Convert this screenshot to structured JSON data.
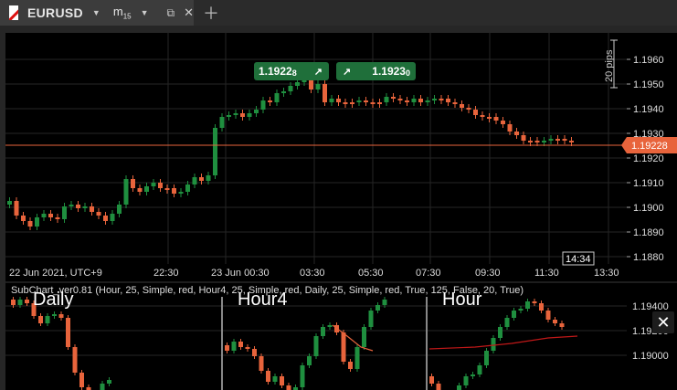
{
  "tab": {
    "symbol": "EURUSD",
    "timeframe_main": "m",
    "timeframe_sub": "15",
    "detach_icon": "detach-icon",
    "close_icon": "close-icon"
  },
  "main_chart": {
    "price_ticks": [
      "1.1960",
      "1.1950",
      "1.1940",
      "1.1930",
      "1.1920",
      "1.1910",
      "1.1900",
      "1.1890",
      "1.1880"
    ],
    "time_ticks": [
      "22 Jun 2021, UTC+9",
      "22:30",
      "23 Jun 00:30",
      "03:30",
      "05:30",
      "07:30",
      "09:30",
      "11:30",
      "13:30"
    ],
    "current_price": "1.19228",
    "cursor_time": "14:34",
    "scale_label": "20 pips",
    "sell_price_main": "1.1922",
    "sell_price_sup": "8",
    "buy_price_main": "1.1923",
    "buy_price_sup": "0",
    "colors": {
      "bull": "#1f8f3f",
      "bear": "#e8643c",
      "price_line": "#e8643c",
      "badge": "#1f6f3a"
    }
  },
  "sub_chart": {
    "title": "SubChart_ver0.81 (Hour, 25, Simple, red, Hour4, 25, Simple, red, Daily, 25, Simple, red, True, 125, False, 20, True)",
    "panels": [
      "Daily",
      "Hour4",
      "Hour"
    ],
    "price_ticks": [
      "1.19400",
      "1.19200",
      "1.19000"
    ],
    "close_label": "✕"
  }
}
